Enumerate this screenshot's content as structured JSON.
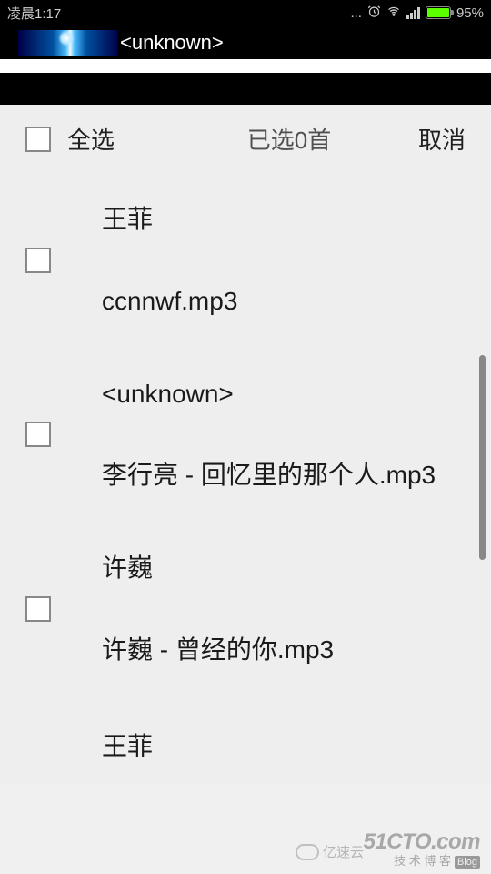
{
  "status_bar": {
    "time": "凌晨1:17",
    "dots": "...",
    "alarm": "⏰",
    "wifi": "📶",
    "battery_pct": "95%"
  },
  "app_header": {
    "title": "<unknown>"
  },
  "controls": {
    "select_all": "全选",
    "selected_count": "已选0首",
    "cancel": "取消"
  },
  "list": [
    {
      "line1": "王菲",
      "line2": "ccnnwf.mp3"
    },
    {
      "line1": "<unknown>",
      "line2": "李行亮 - 回忆里的那个人.mp3"
    },
    {
      "line1": "许巍",
      "line2": "许巍 - 曾经的你.mp3"
    },
    {
      "line1": "王菲",
      "line2": ""
    }
  ],
  "watermark": {
    "side": "亿速云",
    "main": "51CTO.com",
    "sub": "技 术 博 客",
    "blog": "Blog"
  }
}
